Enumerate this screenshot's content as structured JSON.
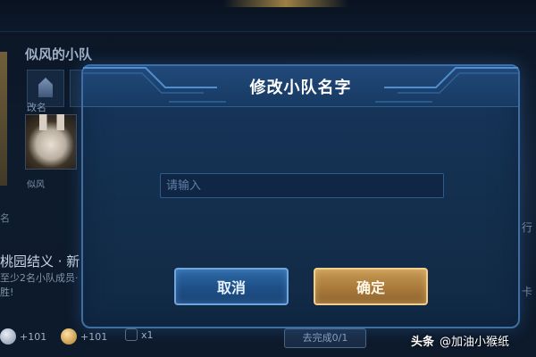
{
  "background": {
    "team_title": "似风的小队",
    "rename_label": "改名",
    "member_name": "似风",
    "small_mark": "名",
    "task_title": "桃园结义 · 新",
    "task_desc": "至少2名小队成员·\n胜!",
    "rewards": [
      {
        "icon": "silver-coin-icon",
        "amount": "+101"
      },
      {
        "icon": "gold-coin-icon",
        "amount": "+101"
      },
      {
        "icon": "heart-icon",
        "amount": "x1"
      }
    ],
    "progress_button": "去完成0/1",
    "right_text_1": "行",
    "right_text_2": "卡"
  },
  "dialog": {
    "title": "修改小队名字",
    "input_placeholder": "请输入",
    "input_value": "",
    "cancel_label": "取消",
    "confirm_label": "确定"
  },
  "watermark": {
    "brand": "头条",
    "account": "@加油小猴纸"
  },
  "colors": {
    "dialog_border": "#3e6ea3",
    "dialog_bg": "#14304f",
    "cancel_button": "#1e4f86",
    "confirm_button": "#a97a3a",
    "confirm_border": "#f0cf8c"
  }
}
